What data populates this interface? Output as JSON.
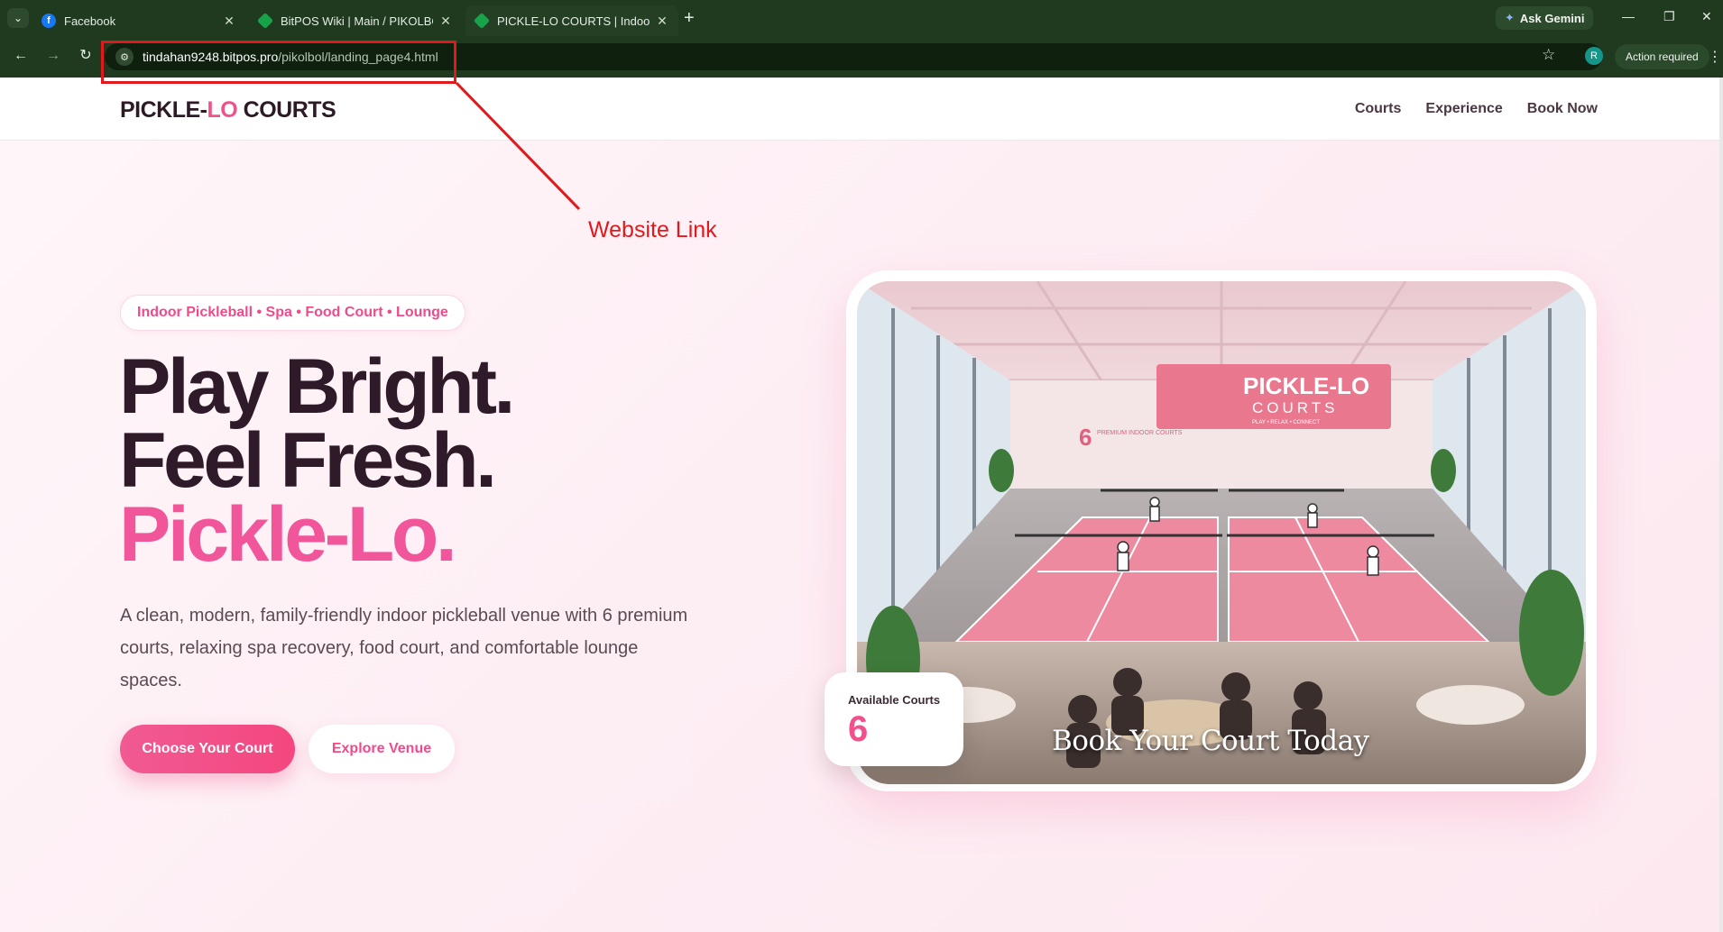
{
  "browser": {
    "tabs": [
      {
        "title": "Facebook",
        "icon": "facebook-icon"
      },
      {
        "title": "BitPOS Wiki | Main / PIKOLBOL",
        "icon": "bitpos-gem-icon"
      },
      {
        "title": "PICKLE-LO COURTS | Indoor Pic",
        "icon": "bitpos-gem-icon",
        "active": true
      }
    ],
    "new_tab": "+",
    "ask_gemini": "Ask Gemini",
    "url_domain": "tindahan9248.bitpos.pro",
    "url_path": "/pikolbol/landing_page4.html",
    "profile_initial": "R",
    "action_required": "Action required"
  },
  "site": {
    "logo_prefix": "PICKLE-",
    "logo_accent": "LO",
    "logo_suffix": " COURTS",
    "nav": [
      "Courts",
      "Experience",
      "Book Now"
    ]
  },
  "hero": {
    "pill": "Indoor Pickleball • Spa • Food Court • Lounge",
    "headline_line1": "Play Bright.",
    "headline_line2": "Feel Fresh.",
    "headline_line3": "Pickle-Lo.",
    "description": "A clean, modern, family-friendly indoor pickleball venue with 6 premium courts, relaxing spa recovery, food court, and comfortable lounge spaces.",
    "primary_button": "Choose Your Court",
    "secondary_button": "Explore Venue",
    "image_overlay": "Book Your Court Today",
    "available_label": "Available Courts",
    "available_count": "6",
    "image_sign_title": "PICKLE-LO",
    "image_sign_sub": "COURTS",
    "image_sign_tag": "PLAY • RELAX • CONNECT",
    "image_wall_number": "6",
    "image_wall_text": "PREMIUM INDOOR COURTS"
  },
  "annotation": {
    "label": "Website Link",
    "color": "#e0191c"
  },
  "colors": {
    "brand_pink": "#f2508c",
    "headline_dark": "#2f1a2a",
    "chrome_green": "#1f3a1f"
  }
}
